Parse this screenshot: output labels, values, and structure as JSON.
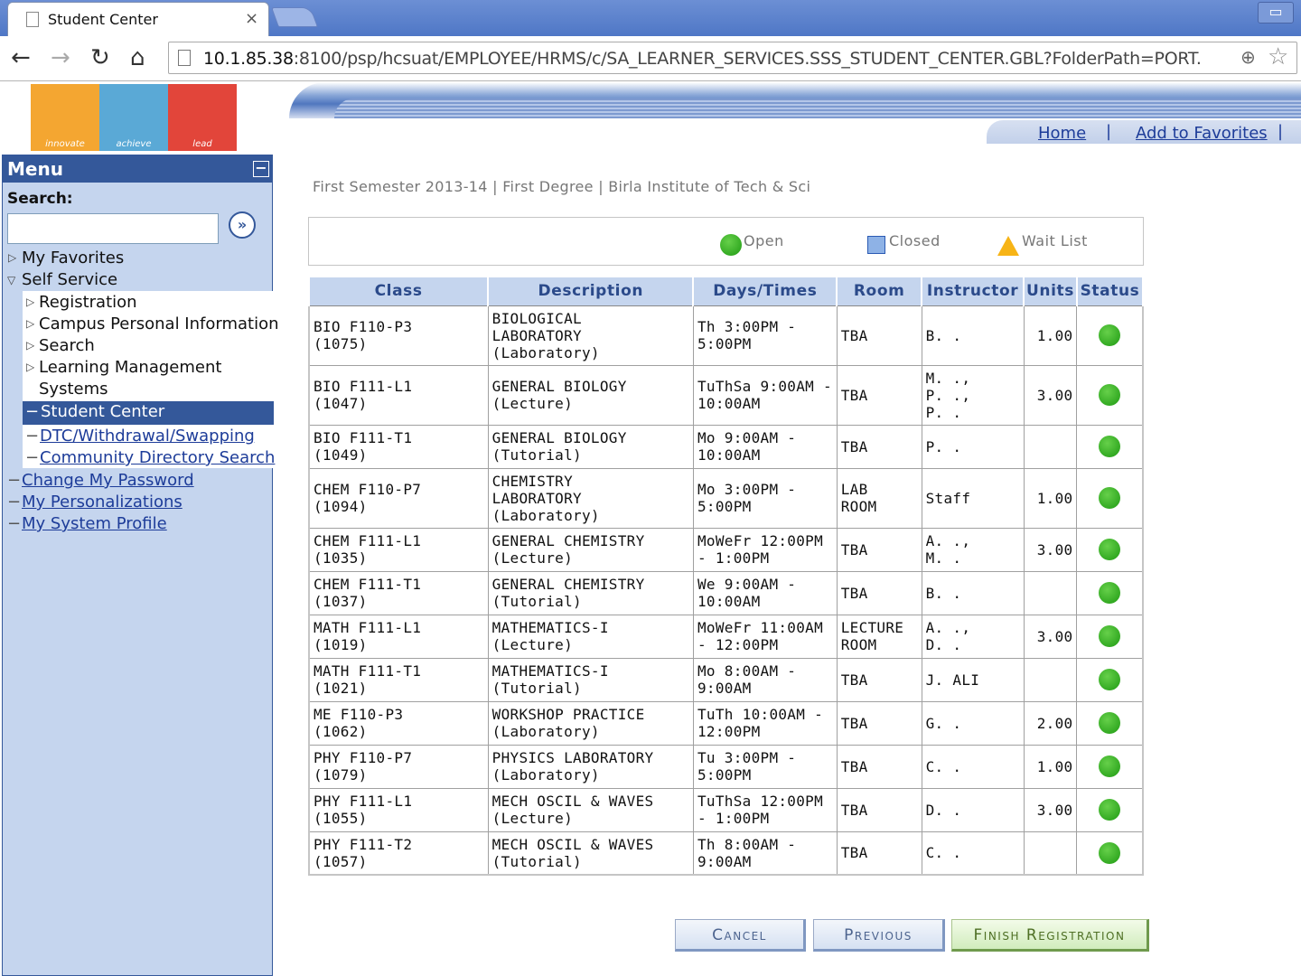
{
  "browser": {
    "tab_title": "Student Center",
    "tab_close": "×",
    "window_min": "▭",
    "url_host": "10.1.85.38",
    "url_rest": ":8100/psp/hcsuat/EMPLOYEE/HRMS/c/SA_LEARNER_SERVICES.SSS_STUDENT_CENTER.GBL?FolderPath=PORT."
  },
  "header": {
    "logo_words": [
      "innovate",
      "achieve",
      "lead"
    ],
    "logo_colors": [
      "#f4a631",
      "#5aa9d6",
      "#e2453a"
    ],
    "home_link": "Home",
    "favorites_link": "Add to Favorites",
    "separator": "|"
  },
  "menu": {
    "title": "Menu",
    "collapse": "−",
    "search_label": "Search:",
    "search_value": "",
    "go": "»",
    "items": {
      "my_favorites": "My Favorites",
      "self_service": "Self Service",
      "registration": "Registration",
      "campus_personal": "Campus Personal Information",
      "search": "Search",
      "lms_line1": "Learning Management",
      "lms_line2": "Systems",
      "student_center": "Student Center",
      "dtc": "DTC/Withdrawal/Swapping",
      "community": "Community Directory Search",
      "change_password": "Change My Password",
      "personalizations": "My Personalizations",
      "system_profile": "My System Profile"
    }
  },
  "content": {
    "term": "First Semester 2013-14 | First Degree | Birla Institute of Tech & Sci",
    "legend": {
      "open": "Open",
      "closed": "Closed",
      "wait_list": "Wait List"
    },
    "columns": [
      "Class",
      "Description",
      "Days/Times",
      "Room",
      "Instructor",
      "Units",
      "Status"
    ],
    "rows": [
      {
        "class_code": "BIO F110-P3",
        "class_nbr": "(1075)",
        "desc": [
          "BIOLOGICAL",
          "LABORATORY",
          "(Laboratory)"
        ],
        "days": [
          "Th 3:00PM -",
          "5:00PM"
        ],
        "room": [
          "TBA"
        ],
        "instructor": [
          "B. ."
        ],
        "units": "1.00",
        "status": "open"
      },
      {
        "class_code": "BIO F111-L1",
        "class_nbr": "(1047)",
        "desc": [
          "GENERAL BIOLOGY",
          "(Lecture)"
        ],
        "days": [
          "TuThSa 9:00AM -",
          "10:00AM"
        ],
        "room": [
          "TBA"
        ],
        "instructor": [
          "M. .,",
          "P. .,",
          "P. ."
        ],
        "units": "3.00",
        "status": "open"
      },
      {
        "class_code": "BIO F111-T1",
        "class_nbr": "(1049)",
        "desc": [
          "GENERAL BIOLOGY",
          "(Tutorial)"
        ],
        "days": [
          "Mo 9:00AM -",
          "10:00AM"
        ],
        "room": [
          "TBA"
        ],
        "instructor": [
          "P. ."
        ],
        "units": "",
        "status": "open"
      },
      {
        "class_code": "CHEM F110-P7",
        "class_nbr": "(1094)",
        "desc": [
          "CHEMISTRY",
          "LABORATORY",
          "(Laboratory)"
        ],
        "days": [
          "Mo 3:00PM -",
          "5:00PM"
        ],
        "room": [
          "LAB",
          "ROOM"
        ],
        "instructor": [
          "Staff"
        ],
        "units": "1.00",
        "status": "open"
      },
      {
        "class_code": "CHEM F111-L1",
        "class_nbr": "(1035)",
        "desc": [
          "GENERAL CHEMISTRY",
          "(Lecture)"
        ],
        "days": [
          "MoWeFr 12:00PM",
          "- 1:00PM"
        ],
        "room": [
          "TBA"
        ],
        "instructor": [
          "A. .,",
          "M. ."
        ],
        "units": "3.00",
        "status": "open"
      },
      {
        "class_code": "CHEM F111-T1",
        "class_nbr": "(1037)",
        "desc": [
          "GENERAL CHEMISTRY",
          "(Tutorial)"
        ],
        "days": [
          "We 9:00AM -",
          "10:00AM"
        ],
        "room": [
          "TBA"
        ],
        "instructor": [
          "B. ."
        ],
        "units": "",
        "status": "open"
      },
      {
        "class_code": "MATH F111-L1",
        "class_nbr": "(1019)",
        "desc": [
          "MATHEMATICS-I",
          "(Lecture)"
        ],
        "days": [
          "MoWeFr 11:00AM",
          "- 12:00PM"
        ],
        "room": [
          "LECTURE",
          "ROOM"
        ],
        "instructor": [
          "A. .,",
          "D. ."
        ],
        "units": "3.00",
        "status": "open"
      },
      {
        "class_code": "MATH F111-T1",
        "class_nbr": "(1021)",
        "desc": [
          "MATHEMATICS-I",
          "(Tutorial)"
        ],
        "days": [
          "Mo 8:00AM -",
          "9:00AM"
        ],
        "room": [
          "TBA"
        ],
        "instructor": [
          "J. ALI"
        ],
        "units": "",
        "status": "open"
      },
      {
        "class_code": "ME F110-P3",
        "class_nbr": "(1062)",
        "desc": [
          "WORKSHOP PRACTICE",
          "(Laboratory)"
        ],
        "days": [
          "TuTh 10:00AM -",
          "12:00PM"
        ],
        "room": [
          "TBA"
        ],
        "instructor": [
          "G. ."
        ],
        "units": "2.00",
        "status": "open"
      },
      {
        "class_code": "PHY F110-P7",
        "class_nbr": "(1079)",
        "desc": [
          "PHYSICS LABORATORY",
          "(Laboratory)"
        ],
        "days": [
          "Tu 3:00PM -",
          "5:00PM"
        ],
        "room": [
          "TBA"
        ],
        "instructor": [
          "C. ."
        ],
        "units": "1.00",
        "status": "open"
      },
      {
        "class_code": "PHY F111-L1",
        "class_nbr": "(1055)",
        "desc": [
          "MECH OSCIL & WAVES",
          "(Lecture)"
        ],
        "days": [
          "TuThSa 12:00PM",
          "- 1:00PM"
        ],
        "room": [
          "TBA"
        ],
        "instructor": [
          "D. ."
        ],
        "units": "3.00",
        "status": "open"
      },
      {
        "class_code": "PHY F111-T2",
        "class_nbr": "(1057)",
        "desc": [
          "MECH OSCIL & WAVES",
          "(Tutorial)"
        ],
        "days": [
          "Th 8:00AM -",
          "9:00AM"
        ],
        "room": [
          "TBA"
        ],
        "instructor": [
          "C. ."
        ],
        "units": "",
        "status": "open"
      }
    ],
    "buttons": {
      "cancel": "Cancel",
      "previous": "Previous",
      "finish": "Finish Registration"
    }
  }
}
